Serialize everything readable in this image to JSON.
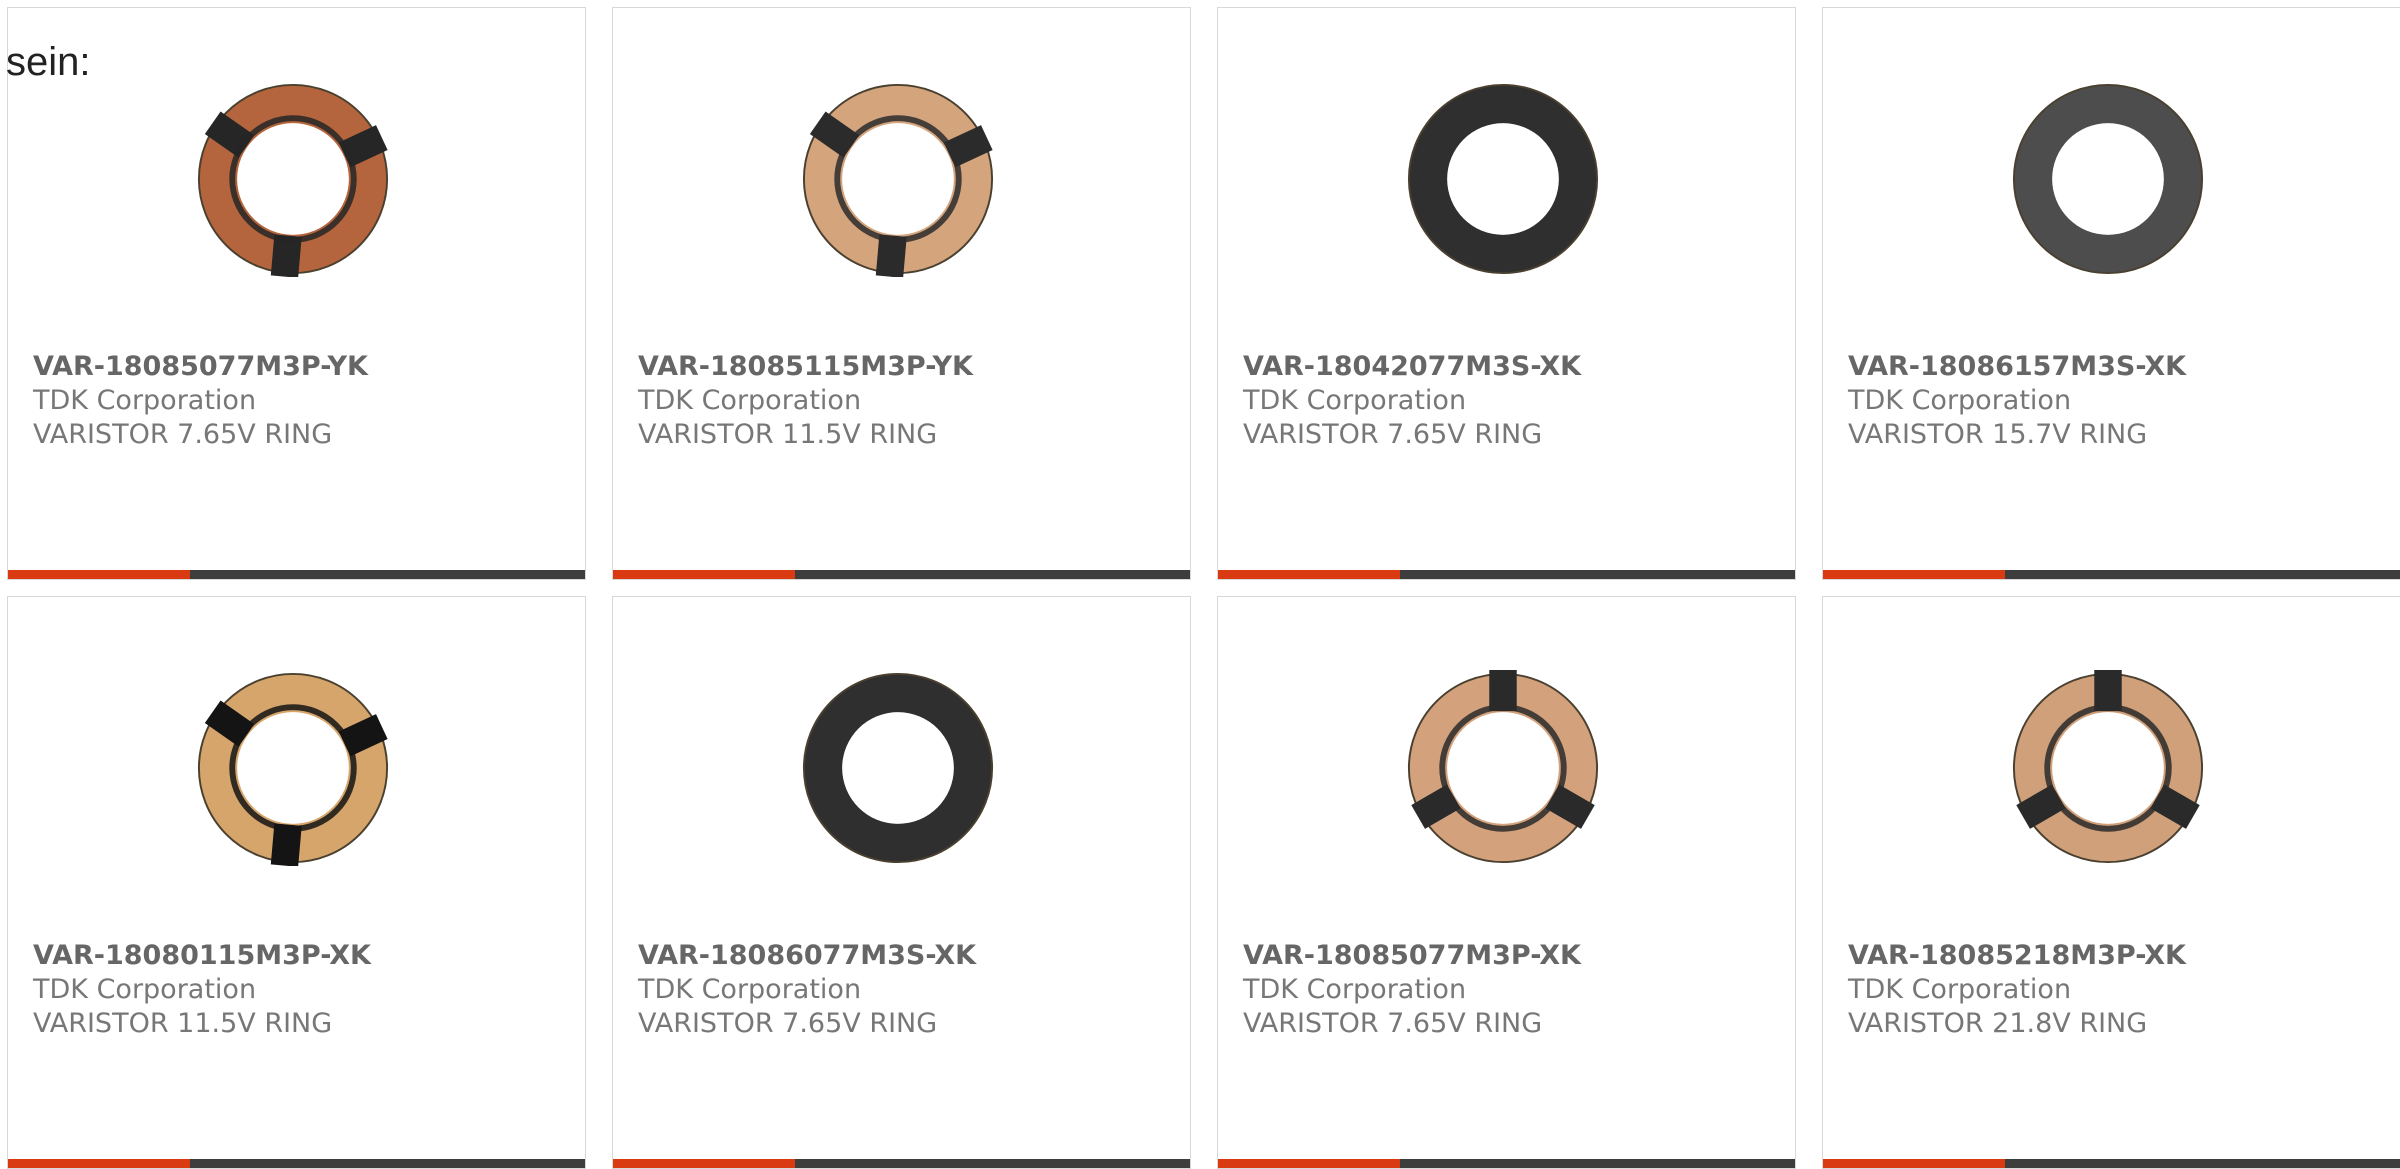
{
  "intro_text": "sein:",
  "colors": {
    "accent": "#d93a12",
    "bar_dark": "#3d3d3d",
    "card_border": "#d8d8d8",
    "text_gray": "#777777"
  },
  "products": [
    {
      "part_number": "VAR-18085077M3P-YK",
      "manufacturer": "TDK Corporation",
      "description": "VARISTOR 7.65V RING",
      "ring_color": "#b5653d",
      "segment_color": "#262626",
      "segments": 3,
      "segment_angle": -25
    },
    {
      "part_number": "VAR-18085115M3P-YK",
      "manufacturer": "TDK Corporation",
      "description": "VARISTOR 11.5V RING",
      "ring_color": "#d4a47d",
      "segment_color": "#2b2b2b",
      "segments": 3,
      "segment_angle": -25
    },
    {
      "part_number": "VAR-18042077M3S-XK",
      "manufacturer": "TDK Corporation",
      "description": "VARISTOR 7.65V RING",
      "ring_color": "#2f2f2f",
      "segment_color": "#2f2f2f",
      "segments": 0,
      "segment_angle": 0
    },
    {
      "part_number": "VAR-18086157M3S-XK",
      "manufacturer": "TDK Corporation",
      "description": "VARISTOR 15.7V RING",
      "ring_color": "#4d4d4d",
      "segment_color": "#4d4d4d",
      "segments": 0,
      "segment_angle": 0
    },
    {
      "part_number": "VAR-18080115M3P-XK",
      "manufacturer": "TDK Corporation",
      "description": "VARISTOR 11.5V RING",
      "ring_color": "#d6a56b",
      "segment_color": "#141414",
      "segments": 3,
      "segment_angle": -25
    },
    {
      "part_number": "VAR-18086077M3S-XK",
      "manufacturer": "TDK Corporation",
      "description": "VARISTOR 7.65V RING",
      "ring_color": "#2f2f2f",
      "segment_color": "#2f2f2f",
      "segments": 0,
      "segment_angle": 0
    },
    {
      "part_number": "VAR-18085077M3P-XK",
      "manufacturer": "TDK Corporation",
      "description": "VARISTOR 7.65V RING",
      "ring_color": "#d3a27d",
      "segment_color": "#2a2a2a",
      "segments": 3,
      "segment_angle": 30
    },
    {
      "part_number": "VAR-18085218M3P-XK",
      "manufacturer": "TDK Corporation",
      "description": "VARISTOR 21.8V RING",
      "ring_color": "#cfa07a",
      "segment_color": "#2a2a2a",
      "segments": 3,
      "segment_angle": 30
    }
  ],
  "progress_fraction": 0.315
}
